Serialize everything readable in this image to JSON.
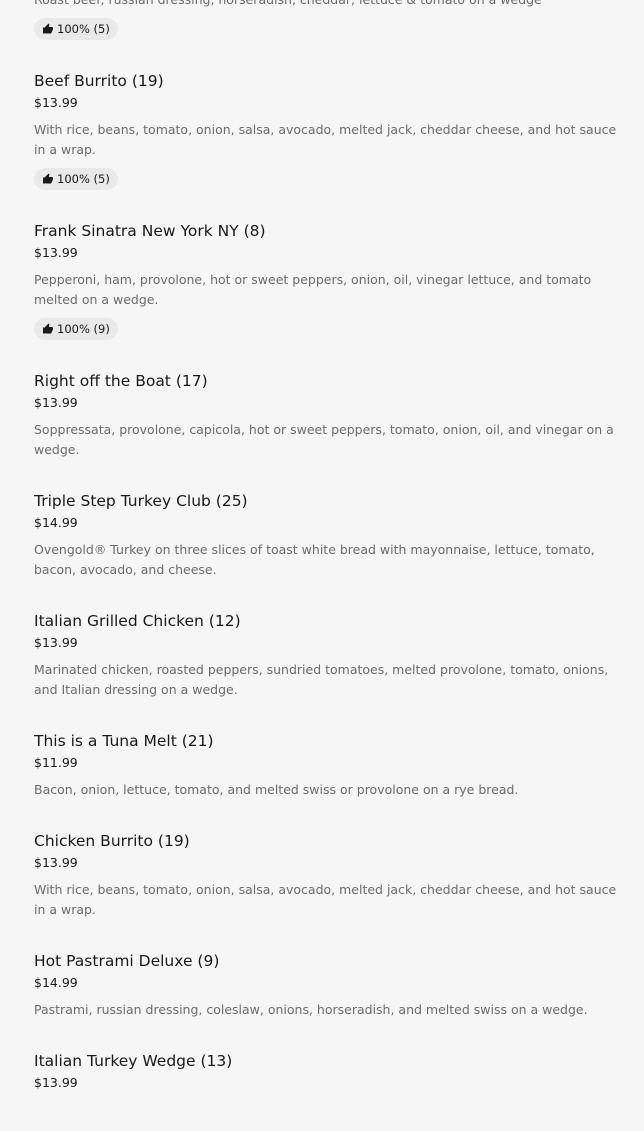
{
  "items": [
    {
      "name": "",
      "price": "",
      "description": "Roast beef, russian dressing, horseradish, cheddar, lettuce & tomato on a wedge",
      "rating": "100% (5)"
    },
    {
      "name": "Beef Burrito (19)",
      "price": "$13.99",
      "description": "With rice, beans, tomato, onion, salsa, avocado, melted jack, cheddar cheese, and hot sauce in a wrap.",
      "rating": "100% (5)"
    },
    {
      "name": "Frank Sinatra New York NY (8)",
      "price": "$13.99",
      "description": "Pepperoni, ham, provolone, hot or sweet peppers, onion, oil, vinegar lettuce, and tomato melted on a wedge.",
      "rating": "100% (9)"
    },
    {
      "name": "Right off the Boat (17)",
      "price": "$13.99",
      "description": "Soppressata, provolone, capicola, hot or sweet peppers, tomato, onion, oil, and vinegar on a wedge.",
      "rating": ""
    },
    {
      "name": "Triple Step Turkey Club (25)",
      "price": "$14.99",
      "description": "Ovengold® Turkey on three slices of toast white bread with mayonnaise, lettuce, tomato, bacon, avocado, and cheese.",
      "rating": ""
    },
    {
      "name": "Italian Grilled Chicken (12)",
      "price": "$13.99",
      "description": "Marinated chicken, roasted peppers, sundried tomatoes, melted provolone, tomato, onions, and Italian dressing on a wedge.",
      "rating": ""
    },
    {
      "name": "This is a Tuna Melt (21)",
      "price": "$11.99",
      "description": "Bacon, onion, lettuce, tomato, and melted swiss or provolone on a rye bread.",
      "rating": ""
    },
    {
      "name": "Chicken Burrito (19)",
      "price": "$13.99",
      "description": "With rice, beans, tomato, onion, salsa, avocado, melted jack, cheddar cheese, and hot sauce in a wrap.",
      "rating": ""
    },
    {
      "name": "Hot Pastrami Deluxe (9)",
      "price": "$14.99",
      "description": "Pastrami, russian dressing, coleslaw, onions, horseradish, and melted swiss on a wedge.",
      "rating": ""
    },
    {
      "name": "Italian Turkey Wedge (13)",
      "price": "$13.99",
      "description": "",
      "rating": ""
    }
  ],
  "icons": {
    "rating": "thumbs-up-icon"
  },
  "colors": {
    "background": "#f6f6f6",
    "text": "#191919",
    "muted": "#6b6b6b",
    "badge": "#e9e9e9"
  }
}
